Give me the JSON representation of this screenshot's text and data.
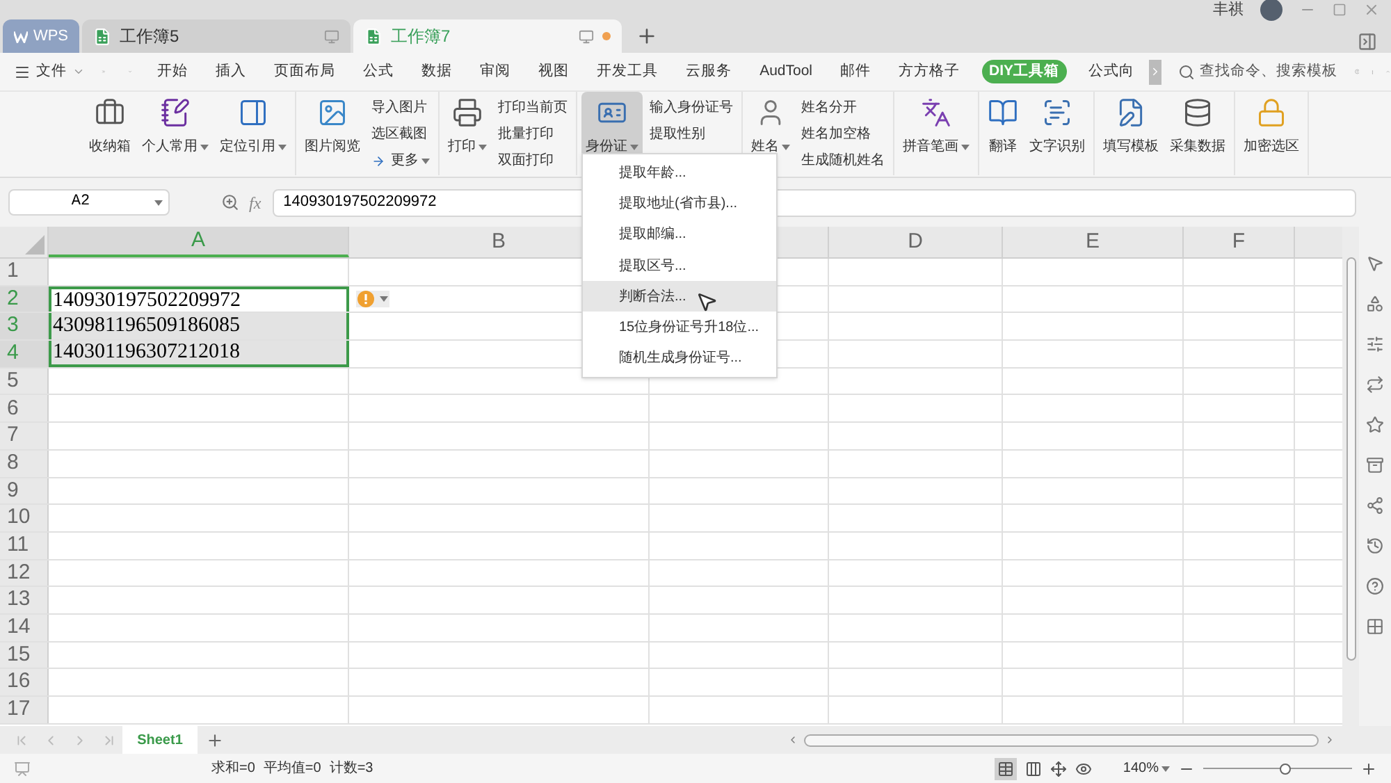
{
  "window": {
    "tabs": [
      {
        "label": "WPS",
        "kind": "app",
        "selected": false
      },
      {
        "label": "工作簿5",
        "kind": "document",
        "selected": false,
        "unsaved": false
      },
      {
        "label": "工作簿7",
        "kind": "document",
        "selected": true,
        "unsaved": true
      }
    ],
    "user_name": "丰祺"
  },
  "menu": {
    "file_label": "文件",
    "items": [
      {
        "label": "开始",
        "selected": false
      },
      {
        "label": "插入",
        "selected": false
      },
      {
        "label": "页面布局",
        "selected": false
      },
      {
        "label": "公式",
        "selected": false
      },
      {
        "label": "数据",
        "selected": false
      },
      {
        "label": "审阅",
        "selected": false
      },
      {
        "label": "视图",
        "selected": false
      },
      {
        "label": "开发工具",
        "selected": false
      },
      {
        "label": "云服务",
        "selected": false
      },
      {
        "label": "AudTool",
        "selected": false
      },
      {
        "label": "邮件",
        "selected": false
      },
      {
        "label": "方方格子",
        "selected": false
      },
      {
        "label": "DIY工具箱",
        "selected": true
      },
      {
        "label": "公式向",
        "selected": false
      }
    ],
    "search_placeholder": "查找命令、搜索模板"
  },
  "ribbon": {
    "groups": [
      {
        "items": [
          {
            "kind": "large",
            "label": "收纳箱",
            "dropdown": false,
            "pressed": false
          },
          {
            "kind": "large",
            "label": "个人常用",
            "dropdown": true,
            "pressed": false
          },
          {
            "kind": "large",
            "label": "定位引用",
            "dropdown": true,
            "pressed": false
          }
        ]
      },
      {
        "items": [
          {
            "kind": "large",
            "label": "图片阅览",
            "dropdown": false,
            "pressed": false
          },
          {
            "kind": "stack",
            "entries": [
              {
                "label": "导入图片",
                "kind": "plain",
                "dropdown": false
              },
              {
                "label": "选区截图",
                "kind": "plain",
                "dropdown": false
              },
              {
                "label": "更多",
                "kind": "link",
                "dropdown": true
              }
            ]
          }
        ]
      },
      {
        "items": [
          {
            "kind": "large",
            "label": "打印",
            "dropdown": true,
            "pressed": false
          },
          {
            "kind": "stack",
            "entries": [
              {
                "label": "打印当前页",
                "kind": "plain",
                "dropdown": false
              },
              {
                "label": "批量打印",
                "kind": "plain",
                "dropdown": false
              },
              {
                "label": "双面打印",
                "kind": "plain",
                "dropdown": false
              }
            ]
          }
        ]
      },
      {
        "items": [
          {
            "kind": "large",
            "label": "身份证",
            "dropdown": true,
            "pressed": true
          },
          {
            "kind": "stack",
            "entries": [
              {
                "label": "输入身份证号",
                "kind": "plain",
                "dropdown": false
              },
              {
                "label": "提取性别",
                "kind": "plain",
                "dropdown": false
              }
            ]
          }
        ]
      },
      {
        "items": [
          {
            "kind": "large",
            "label": "姓名",
            "dropdown": true,
            "pressed": false
          },
          {
            "kind": "stack",
            "entries": [
              {
                "label": "姓名分开",
                "kind": "plain",
                "dropdown": false
              },
              {
                "label": "姓名加空格",
                "kind": "plain",
                "dropdown": false
              },
              {
                "label": "生成随机姓名",
                "kind": "plain",
                "dropdown": false
              }
            ]
          }
        ]
      },
      {
        "items": [
          {
            "kind": "large",
            "label": "拼音笔画",
            "dropdown": true,
            "pressed": false
          }
        ]
      },
      {
        "items": [
          {
            "kind": "large",
            "label": "翻译",
            "dropdown": false,
            "pressed": false
          },
          {
            "kind": "large",
            "label": "文字识别",
            "dropdown": false,
            "pressed": false
          }
        ]
      },
      {
        "items": [
          {
            "kind": "large",
            "label": "填写模板",
            "dropdown": false,
            "pressed": false
          },
          {
            "kind": "large",
            "label": "采集数据",
            "dropdown": false,
            "pressed": false
          }
        ]
      },
      {
        "items": [
          {
            "kind": "large",
            "label": "加密选区",
            "dropdown": false,
            "pressed": false
          }
        ]
      }
    ]
  },
  "dropdown_menu": [
    {
      "label": "提取年龄...",
      "selected": false
    },
    {
      "label": "提取地址(省市县)...",
      "selected": false
    },
    {
      "label": "提取邮编...",
      "selected": false
    },
    {
      "label": "提取区号...",
      "selected": false
    },
    {
      "label": "判断合法...",
      "selected": true
    },
    {
      "label": "15位身份证号升18位...",
      "selected": false
    },
    {
      "label": "随机生成身份证号...",
      "selected": false
    }
  ],
  "formula_bar": {
    "name_box": "A2",
    "function_label": "fx",
    "value": "140930197502209972"
  },
  "columns": [
    {
      "label": "A",
      "kind": "labeled",
      "selected": true
    },
    {
      "label": "B",
      "kind": "labeled",
      "selected": false
    },
    {
      "kind": "covered"
    },
    {
      "label": "D",
      "kind": "labeled",
      "selected": false
    },
    {
      "label": "E",
      "kind": "labeled",
      "selected": false
    },
    {
      "label": "F",
      "kind": "labeled",
      "selected": false
    }
  ],
  "rows": [
    {
      "header": "1",
      "selected": false,
      "active": false
    },
    {
      "header": "2",
      "selected": true,
      "active": true,
      "value": "140930197502209972",
      "warning": true
    },
    {
      "header": "3",
      "selected": true,
      "active": false,
      "value": "430981196509186085"
    },
    {
      "header": "4",
      "selected": true,
      "active": false,
      "value": "140301196307212018"
    },
    {
      "header": "5",
      "selected": false,
      "active": false
    },
    {
      "header": "6",
      "selected": false,
      "active": false
    },
    {
      "header": "7",
      "selected": false,
      "active": false
    },
    {
      "header": "8",
      "selected": false,
      "active": false
    },
    {
      "header": "9",
      "selected": false,
      "active": false
    },
    {
      "header": "10",
      "selected": false,
      "active": false
    },
    {
      "header": "11",
      "selected": false,
      "active": false
    },
    {
      "header": "12",
      "selected": false,
      "active": false
    },
    {
      "header": "13",
      "selected": false,
      "active": false
    },
    {
      "header": "14",
      "selected": false,
      "active": false
    },
    {
      "header": "15",
      "selected": false,
      "active": false
    },
    {
      "header": "16",
      "selected": false,
      "active": false
    },
    {
      "header": "17",
      "selected": false,
      "active": false
    }
  ],
  "sheets": [
    {
      "label": "Sheet1",
      "selected": true
    }
  ],
  "status_bar": {
    "stats": [
      "求和=0",
      "平均值=0",
      "计数=3"
    ],
    "zoom": "140%",
    "zoom_slider": {
      "level": 0.55
    }
  }
}
